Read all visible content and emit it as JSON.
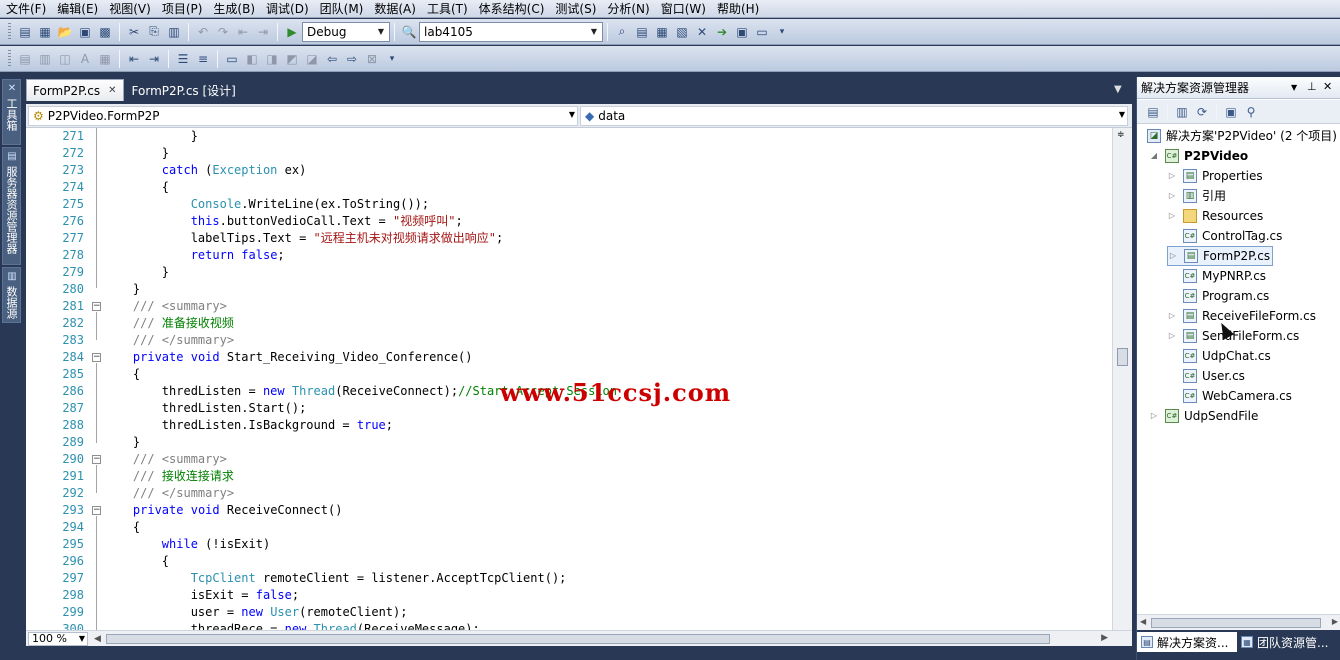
{
  "menu": [
    "文件(F)",
    "编辑(E)",
    "视图(V)",
    "项目(P)",
    "生成(B)",
    "调试(D)",
    "团队(M)",
    "数据(A)",
    "工具(T)",
    "体系结构(C)",
    "测试(S)",
    "分析(N)",
    "窗口(W)",
    "帮助(H)"
  ],
  "toolbar": {
    "config_value": "Debug",
    "platform_value": "lab4105"
  },
  "left_strip": [
    "工具箱",
    "服务器资源管理器",
    "数据源"
  ],
  "editor": {
    "tabs": [
      {
        "label": "FormP2P.cs",
        "active": true
      },
      {
        "label": "FormP2P.cs [设计]",
        "active": false
      }
    ],
    "nav_left": "P2PVideo.FormP2P",
    "nav_right": "data",
    "zoom": "100 %",
    "lines": [
      {
        "n": "271",
        "t": "            }"
      },
      {
        "n": "272",
        "t": "        }"
      },
      {
        "n": "273",
        "t": "        catch (Exception ex)"
      },
      {
        "n": "274",
        "t": "        {"
      },
      {
        "n": "275",
        "t": "            Console.WriteLine(ex.ToString());"
      },
      {
        "n": "276",
        "t": "            this.buttonVedioCall.Text = \"视频呼叫\";"
      },
      {
        "n": "277",
        "t": "            labelTips.Text = \"远程主机未对视频请求做出响应\";"
      },
      {
        "n": "278",
        "t": "            return false;"
      },
      {
        "n": "279",
        "t": "        }"
      },
      {
        "n": "280",
        "t": "    }"
      },
      {
        "n": "281",
        "t": "    /// <summary>"
      },
      {
        "n": "282",
        "t": "    /// 准备接收视频"
      },
      {
        "n": "283",
        "t": "    /// </summary>"
      },
      {
        "n": "284",
        "t": "    private void Start_Receiving_Video_Conference()"
      },
      {
        "n": "285",
        "t": "    {"
      },
      {
        "n": "286",
        "t": "        thredListen = new Thread(ReceiveConnect);//Start Accept Session"
      },
      {
        "n": "287",
        "t": "        thredListen.Start();"
      },
      {
        "n": "288",
        "t": "        thredListen.IsBackground = true;"
      },
      {
        "n": "289",
        "t": "    }"
      },
      {
        "n": "290",
        "t": "    /// <summary>"
      },
      {
        "n": "291",
        "t": "    /// 接收连接请求"
      },
      {
        "n": "292",
        "t": "    /// </summary>"
      },
      {
        "n": "293",
        "t": "    private void ReceiveConnect()"
      },
      {
        "n": "294",
        "t": "    {"
      },
      {
        "n": "295",
        "t": "        while (!isExit)"
      },
      {
        "n": "296",
        "t": "        {"
      },
      {
        "n": "297",
        "t": "            TcpClient remoteClient = listener.AcceptTcpClient();"
      },
      {
        "n": "298",
        "t": "            isExit = false;"
      },
      {
        "n": "299",
        "t": "            user = new User(remoteClient);"
      },
      {
        "n": "300",
        "t": "            threadRece = new Thread(ReceiveMessage);"
      }
    ],
    "watermark": "www.51ccsj.com"
  },
  "solution_explorer": {
    "title": "解决方案资源管理器",
    "items": [
      {
        "label": "解决方案'P2PVideo' (2 个项目)",
        "kind": "solution",
        "level": 0,
        "expander": "",
        "bold": false,
        "selected": false
      },
      {
        "label": "P2PVideo",
        "kind": "project",
        "level": 0,
        "expander": "◢",
        "bold": true,
        "selected": false
      },
      {
        "label": "Properties",
        "kind": "props",
        "level": 1,
        "expander": "▷",
        "bold": false,
        "selected": false
      },
      {
        "label": "引用",
        "kind": "refs",
        "level": 1,
        "expander": "▷",
        "bold": false,
        "selected": false
      },
      {
        "label": "Resources",
        "kind": "folder",
        "level": 1,
        "expander": "▷",
        "bold": false,
        "selected": false
      },
      {
        "label": "ControlTag.cs",
        "kind": "cs",
        "level": 1,
        "expander": "",
        "bold": false,
        "selected": false
      },
      {
        "label": "FormP2P.cs",
        "kind": "form",
        "level": 1,
        "expander": "▷",
        "bold": false,
        "selected": true
      },
      {
        "label": "MyPNRP.cs",
        "kind": "cs",
        "level": 1,
        "expander": "",
        "bold": false,
        "selected": false
      },
      {
        "label": "Program.cs",
        "kind": "cs",
        "level": 1,
        "expander": "",
        "bold": false,
        "selected": false
      },
      {
        "label": "ReceiveFileForm.cs",
        "kind": "form",
        "level": 1,
        "expander": "▷",
        "bold": false,
        "selected": false
      },
      {
        "label": "SendFileForm.cs",
        "kind": "form",
        "level": 1,
        "expander": "▷",
        "bold": false,
        "selected": false
      },
      {
        "label": "UdpChat.cs",
        "kind": "cs",
        "level": 1,
        "expander": "",
        "bold": false,
        "selected": false
      },
      {
        "label": "User.cs",
        "kind": "cs",
        "level": 1,
        "expander": "",
        "bold": false,
        "selected": false
      },
      {
        "label": "WebCamera.cs",
        "kind": "cs",
        "level": 1,
        "expander": "",
        "bold": false,
        "selected": false
      },
      {
        "label": "UdpSendFile",
        "kind": "project",
        "level": 0,
        "expander": "▷",
        "bold": false,
        "selected": false
      }
    ],
    "bottom_tabs": [
      "解决方案资...",
      "团队资源管..."
    ]
  }
}
